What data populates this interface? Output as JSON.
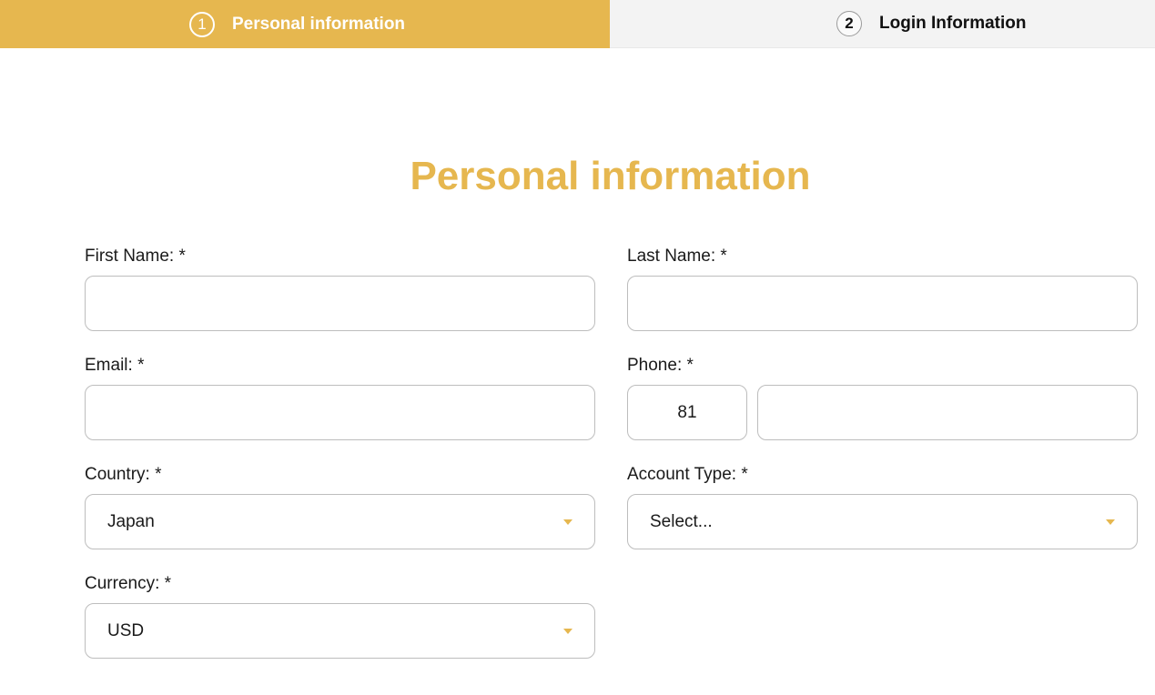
{
  "steps": [
    {
      "number": "1",
      "label": "Personal information",
      "active": true
    },
    {
      "number": "2",
      "label": "Login Information",
      "active": false
    }
  ],
  "form": {
    "title": "Personal information",
    "first_name": {
      "label": "First Name: *",
      "value": ""
    },
    "last_name": {
      "label": "Last Name: *",
      "value": ""
    },
    "email": {
      "label": "Email: *",
      "value": ""
    },
    "phone": {
      "label": "Phone: *",
      "country_code": "81",
      "number": ""
    },
    "country": {
      "label": "Country: *",
      "selected": "Japan"
    },
    "account_type": {
      "label": "Account Type: *",
      "selected": "Select..."
    },
    "currency": {
      "label": "Currency: *",
      "selected": "USD"
    }
  },
  "colors": {
    "accent": "#e6b74f",
    "inactive_step_bg": "#f3f3f3",
    "field_border": "#bdbdbd"
  },
  "icons": {
    "dropdown": "chevron-down-icon"
  }
}
